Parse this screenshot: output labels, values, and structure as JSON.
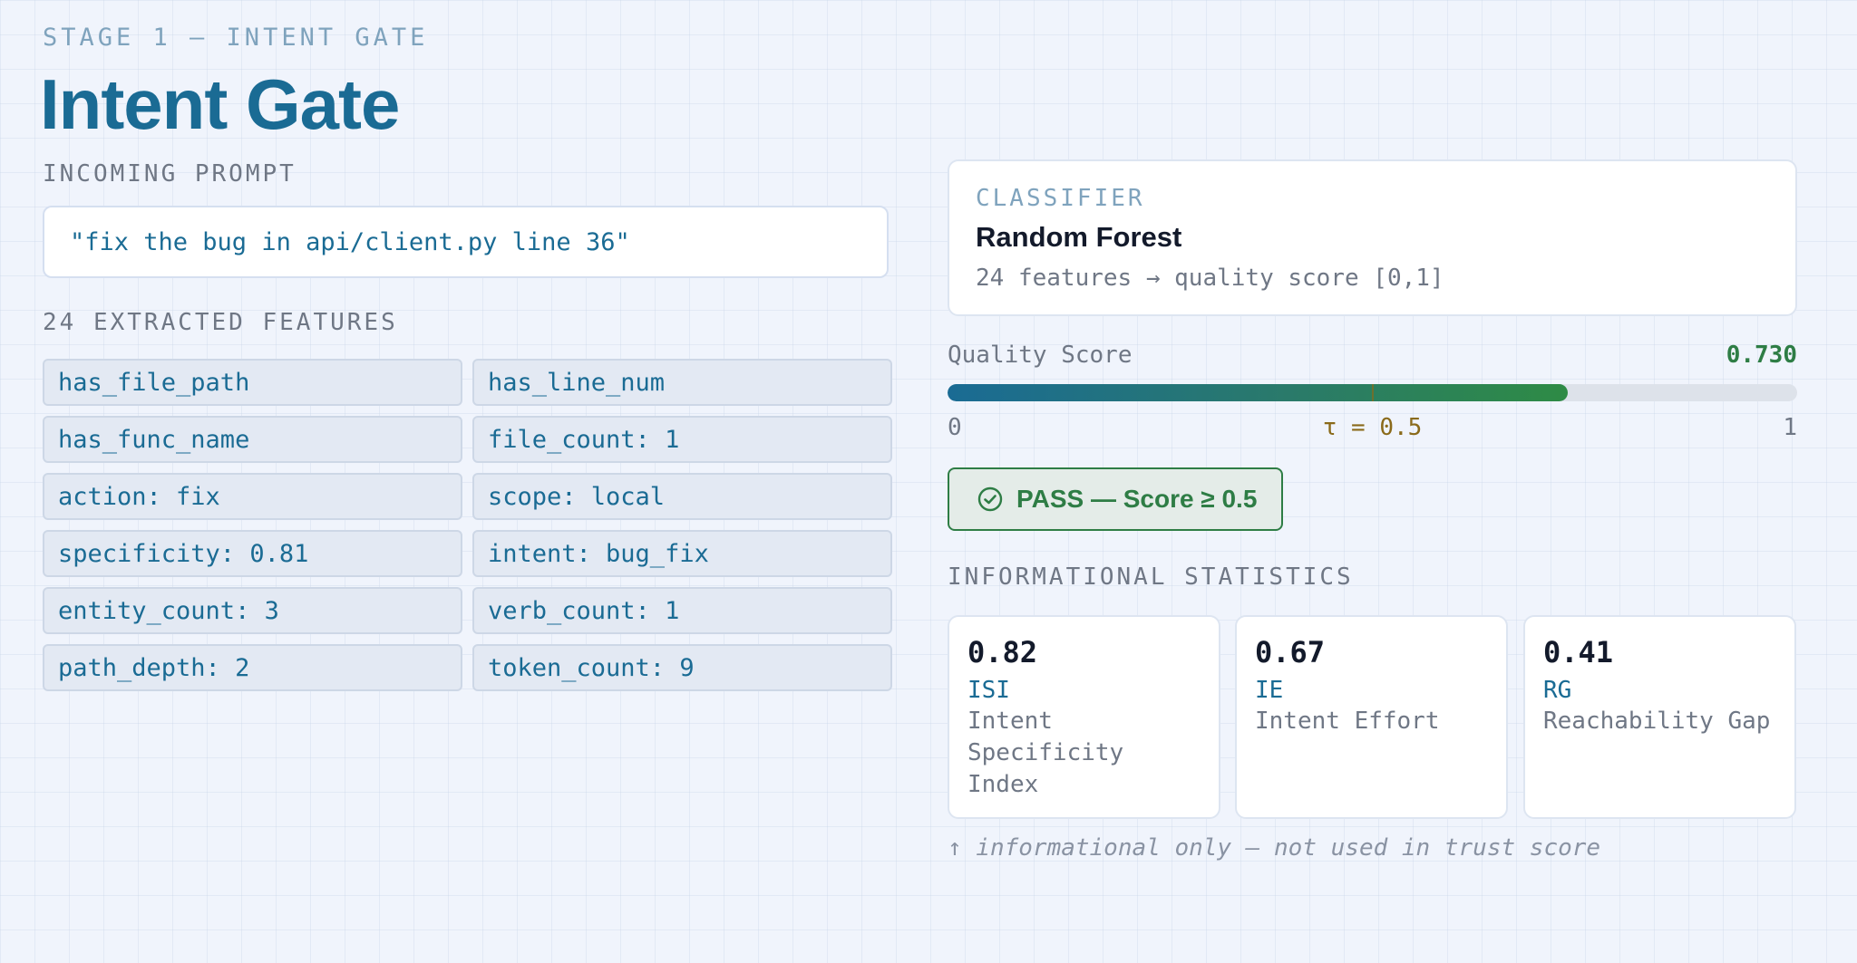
{
  "header": {
    "stage_label": "STAGE 1 — INTENT GATE",
    "title": "Intent Gate"
  },
  "prompt": {
    "section_label": "INCOMING PROMPT",
    "text": "\"fix the bug in api/client.py line 36\""
  },
  "features": {
    "section_label": "24 EXTRACTED FEATURES",
    "items": [
      "has_file_path",
      "has_line_num",
      "has_func_name",
      "file_count: 1",
      "action: fix",
      "scope: local",
      "specificity: 0.81",
      "intent: bug_fix",
      "entity_count: 3",
      "verb_count: 1",
      "path_depth: 2",
      "token_count: 9"
    ]
  },
  "classifier": {
    "tag": "CLASSIFIER",
    "name": "Random Forest",
    "description": "24 features → quality score [0,1]"
  },
  "quality": {
    "label": "Quality Score",
    "value_text": "0.730",
    "value": 0.73,
    "threshold": 0.5,
    "threshold_label": "τ = 0.5",
    "axis_min": "0",
    "axis_max": "1"
  },
  "result": {
    "text": "PASS — Score ≥ 0.5",
    "icon": "check-circle-icon",
    "color": "#2e7d45"
  },
  "stats": {
    "section_label": "INFORMATIONAL STATISTICS",
    "items": [
      {
        "value": "0.82",
        "abbr": "ISI",
        "name": "Intent Specificity Index"
      },
      {
        "value": "0.67",
        "abbr": "IE",
        "name": "Intent Effort"
      },
      {
        "value": "0.41",
        "abbr": "RG",
        "name": "Reachability Gap"
      }
    ],
    "note": "↑ informational only — not used in trust score"
  },
  "colors": {
    "accent": "#1a6b94",
    "pass": "#2e7d45",
    "threshold": "#8a6a1a"
  }
}
